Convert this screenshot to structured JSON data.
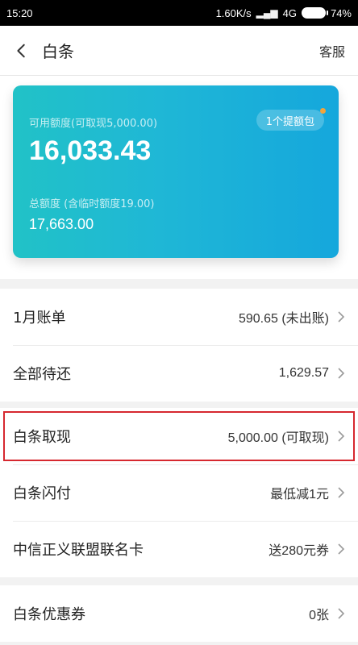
{
  "status_bar": {
    "time": "15:20",
    "speed": "1.60K/s",
    "network": "4G",
    "battery": "74%"
  },
  "header": {
    "title": "白条",
    "service": "客服"
  },
  "card": {
    "available_label": "可用额度(可取现5,000.00)",
    "available_amount": "16,033.43",
    "promo_pill": "1个提额包",
    "total_label": "总额度 (含临时额度19.00)",
    "total_amount": "17,663.00",
    "colors": {
      "start": "#21c2c7",
      "end": "#15a7dc"
    }
  },
  "group1": [
    {
      "title": "1月账单",
      "value": "590.65 (未出账)"
    },
    {
      "title": "全部待还",
      "value": "1,629.57"
    }
  ],
  "group2": [
    {
      "title": "白条取现",
      "value": "5,000.00 (可取现)",
      "highlighted": true
    },
    {
      "title": "白条闪付",
      "value": "最低减1元"
    },
    {
      "title": "中信正义联盟联名卡",
      "value": "送280元券"
    }
  ],
  "group3": [
    {
      "title": "白条优惠券",
      "value": "0张"
    }
  ]
}
